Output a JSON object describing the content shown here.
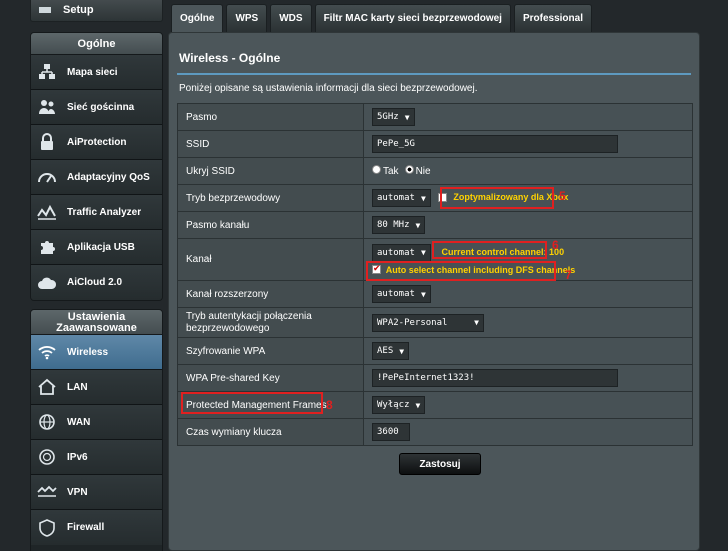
{
  "sidebar": {
    "setup_label": "Setup",
    "general_heading": "Ogólne",
    "general_items": [
      {
        "label": "Mapa sieci",
        "icon": "network-map-icon"
      },
      {
        "label": "Sieć gościnna",
        "icon": "guest-network-icon"
      },
      {
        "label": "AiProtection",
        "icon": "aiprotection-lock-icon"
      },
      {
        "label": "Adaptacyjny QoS",
        "icon": "qos-gauge-icon"
      },
      {
        "label": "Traffic Analyzer",
        "icon": "traffic-analyzer-icon"
      },
      {
        "label": "Aplikacja USB",
        "icon": "usb-puzzle-icon"
      },
      {
        "label": "AiCloud 2.0",
        "icon": "cloud-icon"
      }
    ],
    "advanced_heading": "Ustawienia Zaawansowane",
    "advanced_items": [
      {
        "label": "Wireless",
        "icon": "wifi-icon",
        "active": true
      },
      {
        "label": "LAN",
        "icon": "home-icon"
      },
      {
        "label": "WAN",
        "icon": "globe-icon"
      },
      {
        "label": "IPv6",
        "icon": "ipv6-globe-icon"
      },
      {
        "label": "VPN",
        "icon": "vpn-icon"
      },
      {
        "label": "Firewall",
        "icon": "shield-icon"
      }
    ]
  },
  "tabs": [
    "Ogólne",
    "WPS",
    "WDS",
    "Filtr MAC karty sieci bezprzewodowej",
    "Professional"
  ],
  "page": {
    "title": "Wireless - Ogólne",
    "description": "Poniżej opisane są ustawienia informacji dla sieci bezprzewodowej."
  },
  "form": {
    "band_label": "Pasmo",
    "band_value": "5GHz",
    "ssid_label": "SSID",
    "ssid_value": "PePe_5G",
    "hide_ssid_label": "Ukryj SSID",
    "hide_yes": "Tak",
    "hide_no": "Nie",
    "mode_label": "Tryb bezprzewodowy",
    "mode_value": "automat",
    "xbox_label": "Zoptymalizowany dla Xbox",
    "bandwidth_label": "Pasmo kanału",
    "bandwidth_value": "80 MHz",
    "channel_label": "Kanał",
    "channel_value": "automat",
    "current_channel": "Current control channel: 100",
    "dfs_label": "Auto select channel including DFS channels",
    "ext_channel_label": "Kanał rozszerzony",
    "ext_channel_value": "automat",
    "auth_label": "Tryb autentykacji połączenia bezprzewodowego",
    "auth_value": "WPA2-Personal",
    "encryption_label": "Szyfrowanie WPA",
    "encryption_value": "AES",
    "psk_label": "WPA Pre-shared Key",
    "psk_value": "!PePeInternet1323!",
    "pmf_label": "Protected Management Frames",
    "pmf_value": "Wyłącz",
    "rekey_label": "Czas wymiany klucza",
    "rekey_value": "3600"
  },
  "annotations": [
    "5",
    "6",
    "7",
    "8"
  ],
  "apply_label": "Zastosuj",
  "colors": {
    "accent_blue": "#5e9ac0",
    "annotation_red": "#e02020",
    "note_yellow": "#ffd200"
  }
}
